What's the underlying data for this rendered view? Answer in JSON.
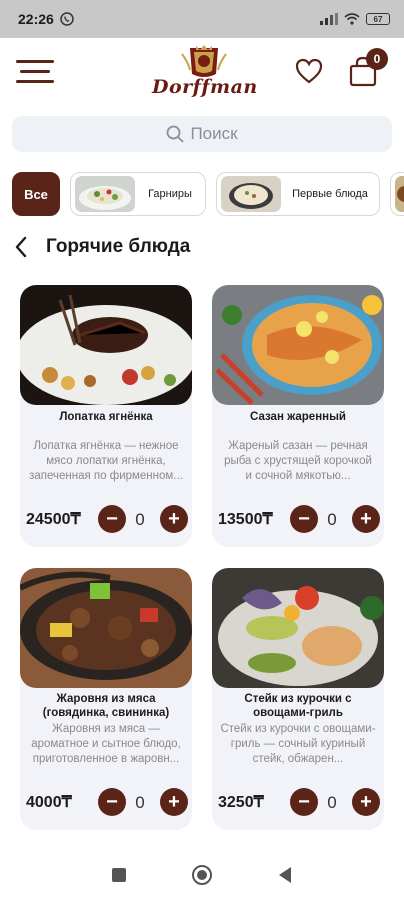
{
  "status_bar": {
    "time": "22:26",
    "battery": "67"
  },
  "header": {
    "logo_text": "Dorffman",
    "cart_count": "0",
    "icons": [
      "menu-icon",
      "heart-icon",
      "cart-icon"
    ]
  },
  "search": {
    "placeholder": "Поиск"
  },
  "categories": [
    {
      "label": "Все",
      "active": true
    },
    {
      "label": "Гарниры",
      "active": false
    },
    {
      "label": "Первые блюда",
      "active": false
    }
  ],
  "section": {
    "title": "Горячие блюда"
  },
  "products": [
    {
      "name": "Лопатка ягнёнка",
      "description": "Лопатка ягнёнка — нежное мясо лопатки ягнёнка, запеченная по фирменном...",
      "price": "24500₸",
      "quantity": "0"
    },
    {
      "name": "Сазан жаренный",
      "description": "Жареный сазан — речная рыба с хрустящей корочкой и сочной мякотью...",
      "price": "13500₸",
      "quantity": "0"
    },
    {
      "name": "Жаровня из мяса (говядинка, свининка)",
      "description": "Жаровня из мяса — ароматное и сытное блюдо, приготовленное в жаровн...",
      "price": "4000₸",
      "quantity": "0"
    },
    {
      "name": "Стейк из курочки с овощами-гриль",
      "description": "Стейк из курочки с овощами-гриль — сочный куриный стейк, обжарен...",
      "price": "3250₸",
      "quantity": "0"
    }
  ],
  "colors": {
    "brand": "#5a2418",
    "card_bg": "#f2f3f8",
    "search_bg": "#eef1f6"
  }
}
